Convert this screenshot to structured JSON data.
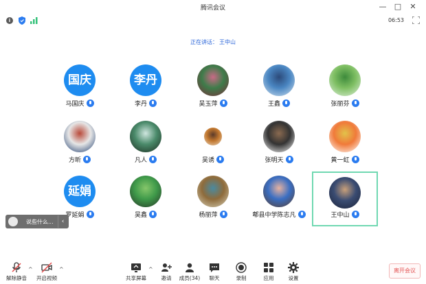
{
  "window": {
    "title": "腾讯会议",
    "minimize": "—",
    "maximize": "□",
    "close": "✕"
  },
  "infobar": {
    "time": "06:53"
  },
  "speaking": {
    "label": "正在讲话：",
    "name": "王中山"
  },
  "participants": [
    {
      "name": "马国庆",
      "avatar_text": "国庆",
      "avatar_type": "text"
    },
    {
      "name": "李丹",
      "avatar_text": "李丹",
      "avatar_type": "text"
    },
    {
      "name": "吴玉萍",
      "avatar_type": "photo",
      "colors": [
        "#7a2c3a",
        "#3e7c4a",
        "#c96a86"
      ]
    },
    {
      "name": "王鑫",
      "avatar_type": "photo",
      "colors": [
        "#cfe0ee",
        "#4a86c2",
        "#2c4a7a"
      ]
    },
    {
      "name": "张丽芬",
      "avatar_type": "photo",
      "colors": [
        "#dff0dc",
        "#7fbf63",
        "#3d8a3b"
      ]
    },
    {
      "name": "方昕",
      "avatar_type": "photo",
      "colors": [
        "#1f3e70",
        "#e6e6e6",
        "#b94a3a"
      ]
    },
    {
      "name": "凡人",
      "avatar_type": "photo",
      "colors": [
        "#1c2c20",
        "#4a8a6a",
        "#cfe6df"
      ]
    },
    {
      "name": "吴诱",
      "avatar_type": "small",
      "colors": [
        "#e9d7c0",
        "#c2782f",
        "#5a3a2a"
      ]
    },
    {
      "name": "张明天",
      "avatar_type": "photo",
      "colors": [
        "#ffffff",
        "#333333",
        "#8a6a50"
      ]
    },
    {
      "name": "黄一虹",
      "avatar_type": "photo",
      "colors": [
        "#ffffff",
        "#f07a3a",
        "#e2c24a"
      ]
    },
    {
      "name": "罗延娟",
      "avatar_text": "延娟",
      "avatar_type": "text"
    },
    {
      "name": "吴鑫",
      "avatar_type": "photo",
      "colors": [
        "#263426",
        "#3f9a4a",
        "#86c66a"
      ]
    },
    {
      "name": "杨丽萍",
      "avatar_type": "photo",
      "colors": [
        "#d8d2b9",
        "#8e6b3b",
        "#4a8aa0"
      ]
    },
    {
      "name": "郫县中学陈志凡",
      "avatar_type": "photo",
      "colors": [
        "#5a3c2a",
        "#3a6ec2",
        "#e7b2a0"
      ]
    },
    {
      "name": "王中山",
      "avatar_type": "photo",
      "active": true,
      "colors": [
        "#1b2238",
        "#3a4c72",
        "#c9a07a"
      ]
    }
  ],
  "floating": {
    "text": "说些什么..."
  },
  "toolbar": {
    "mute": "解除静音",
    "video": "开启视频",
    "share": "共享屏幕",
    "invite": "邀请",
    "members": "成员(34)",
    "chat": "聊天",
    "record": "录制",
    "apps": "应用",
    "settings": "设置",
    "end": "离开会议"
  }
}
